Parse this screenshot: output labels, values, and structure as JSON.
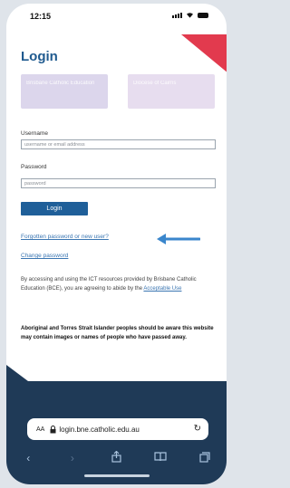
{
  "status_bar": {
    "time": "12:15"
  },
  "page": {
    "title": "Login",
    "logo_left_text": "Brisbane Catholic Education",
    "logo_right_text": "Diocese of Cairns"
  },
  "form": {
    "username_label": "Username",
    "username_placeholder": "username or email address",
    "password_label": "Password",
    "password_placeholder": "password",
    "login_button": "Login"
  },
  "links": {
    "forgotten": "Forgotten password or new user?",
    "change_password": "Change password"
  },
  "notice": {
    "text_before_link": "By accessing and using the ICT resources provided by Brisbane Catholic Education (BCE), you are agreeing to abide by the ",
    "link_text": "Acceptable Use",
    "warning": "Aboriginal and Torres Strait Islander peoples should be aware this website may contain images or names of people who have passed away."
  },
  "browser": {
    "aa_label": "AA",
    "url": "login.bne.catholic.edu.au"
  },
  "colors": {
    "accent": "#1f5f99",
    "link": "#3b76b2",
    "red_corner": "#e23a4e",
    "footer": "#1f3a57",
    "arrow": "#3a86cc"
  },
  "icons": {
    "status": [
      "signal-icon",
      "wifi-icon",
      "battery-icon"
    ],
    "toolbar": [
      "back-icon",
      "forward-icon",
      "share-icon",
      "bookmarks-icon",
      "tabs-icon"
    ]
  }
}
